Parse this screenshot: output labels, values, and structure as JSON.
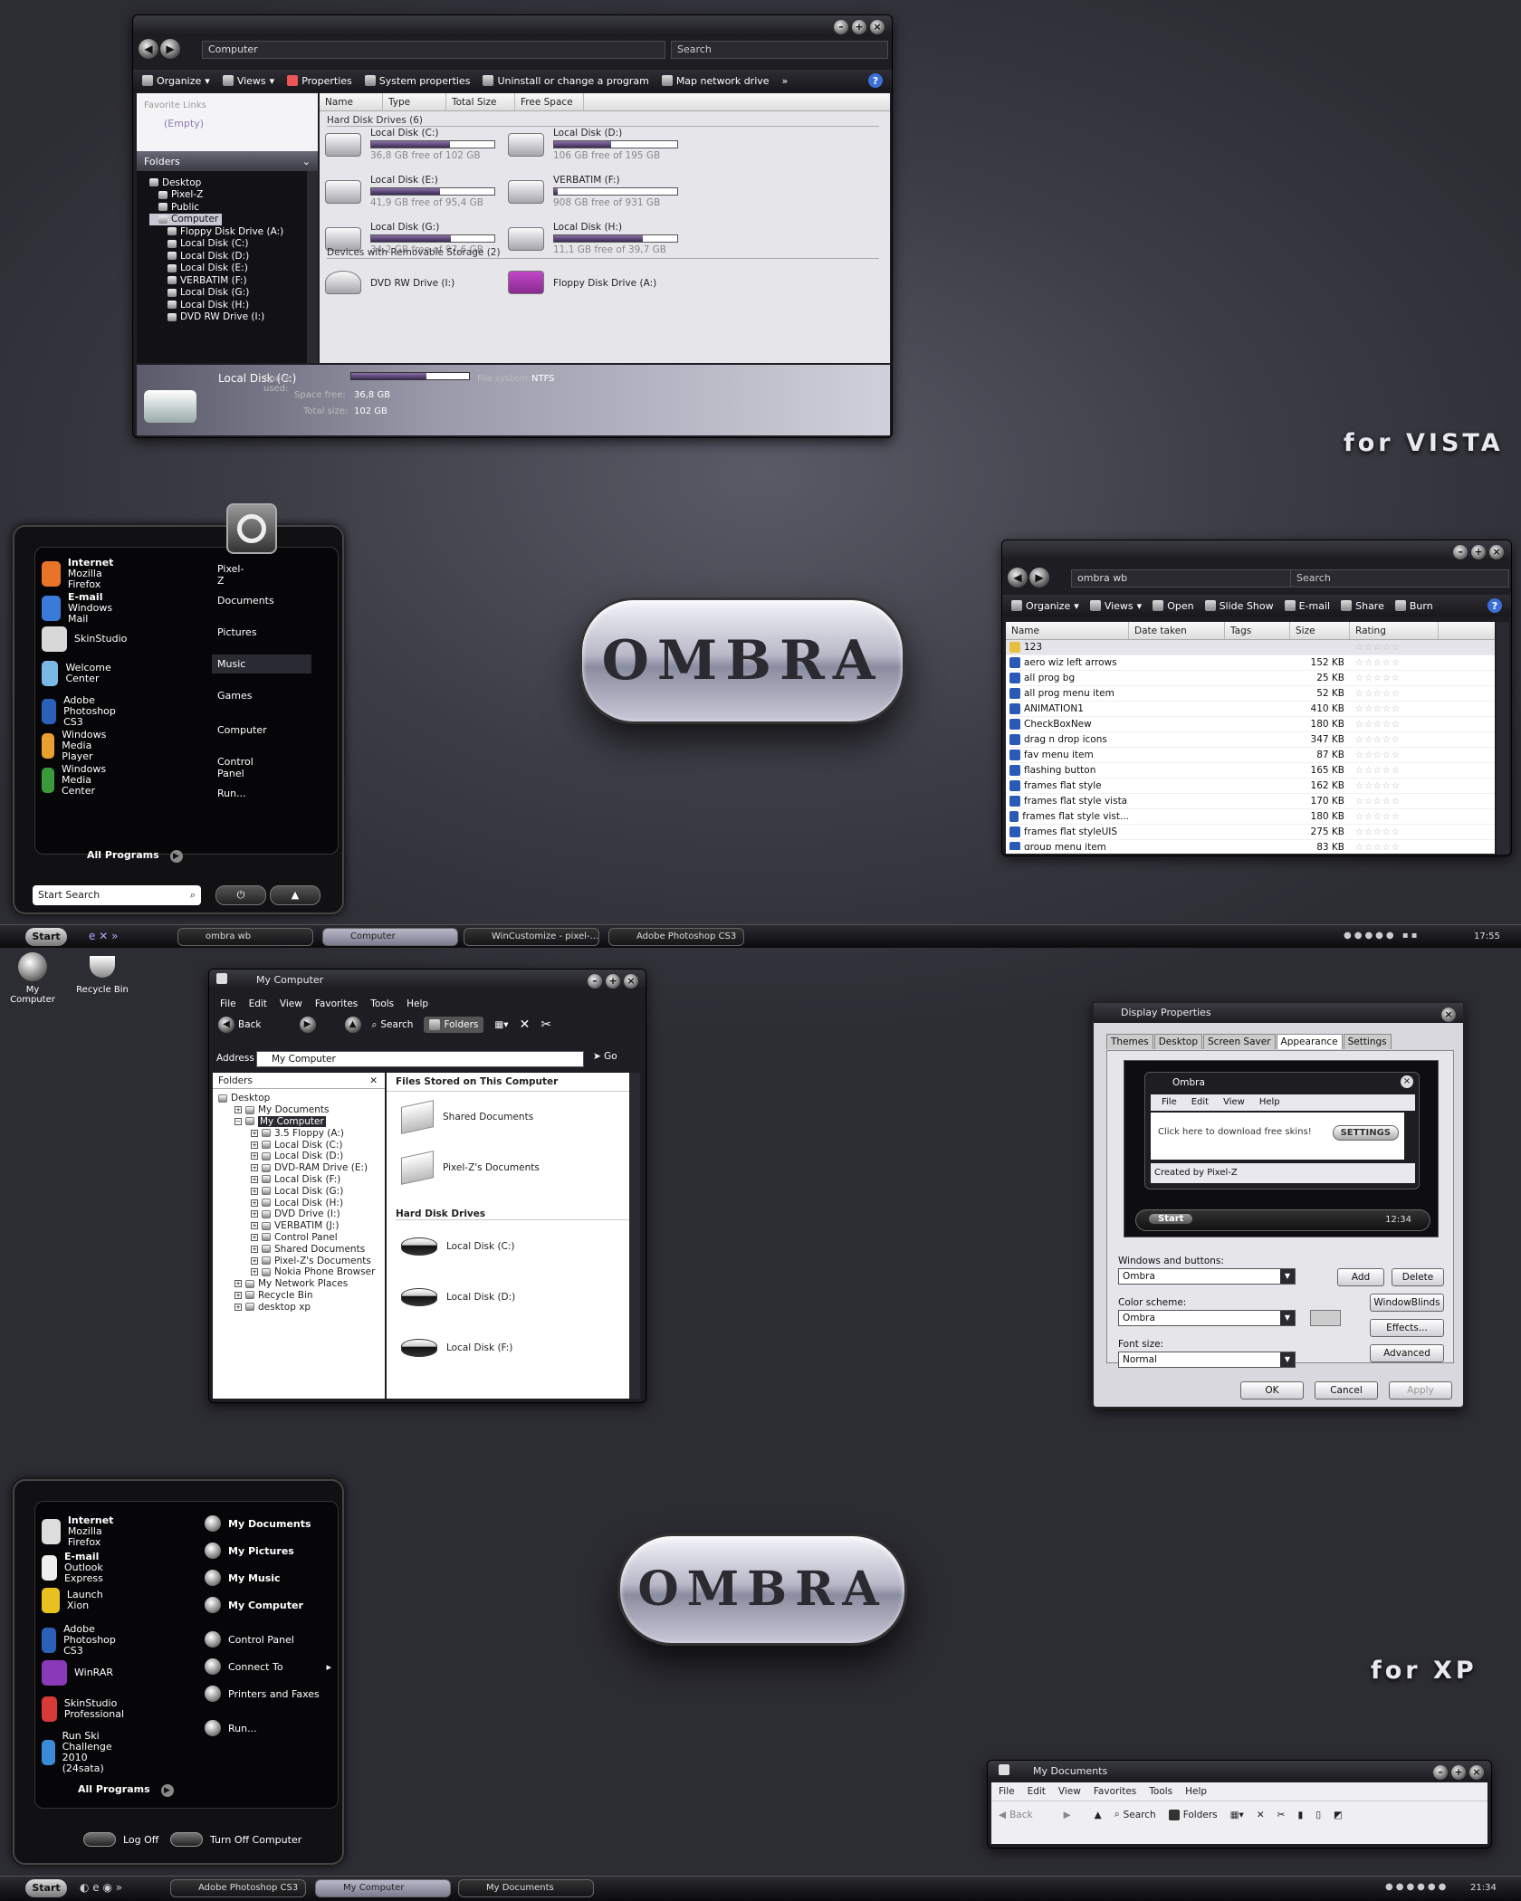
{
  "vista_explorer": {
    "address": "Computer",
    "search_placeholder": "Search",
    "toolbar": [
      "Organize",
      "Views",
      "Properties",
      "System properties",
      "Uninstall or change a program",
      "Map network drive"
    ],
    "favorite_links": "Favorite Links",
    "empty": "(Empty)",
    "folders": "Folders",
    "tree": [
      "Desktop",
      "Pixel-Z",
      "Public",
      "Computer",
      "Floppy Disk Drive (A:)",
      "Local Disk (C:)",
      "Local Disk (D:)",
      "Local Disk (E:)",
      "VERBATIM (F:)",
      "Local Disk (G:)",
      "Local Disk (H:)",
      "DVD RW Drive (I:)"
    ],
    "columns": [
      "Name",
      "Type",
      "Total Size",
      "Free Space"
    ],
    "group_hdd": "Hard Disk Drives (6)",
    "group_removable": "Devices with Removable Storage (2)",
    "drives": [
      {
        "name": "Local Disk (C:)",
        "free": "36,8 GB free of 102 GB",
        "used_fraction": 0.64
      },
      {
        "name": "Local Disk (D:)",
        "free": "106 GB free of 195 GB",
        "used_fraction": 0.46
      },
      {
        "name": "Local Disk (E:)",
        "free": "41,9 GB free of 95,4 GB",
        "used_fraction": 0.56
      },
      {
        "name": "VERBATIM (F:)",
        "free": "908 GB free of 931 GB",
        "used_fraction": 0.03
      },
      {
        "name": "Local Disk (G:)",
        "free": "34,2 GB free of 97,6 GB",
        "used_fraction": 0.65
      },
      {
        "name": "Local Disk (H:)",
        "free": "11,1 GB free of 39,7 GB",
        "used_fraction": 0.72
      }
    ],
    "removable": [
      "DVD RW Drive (I:)",
      "Floppy Disk Drive (A:)"
    ],
    "details": {
      "name": "Local Disk (C:)",
      "space_used_label": "Space used:",
      "space_free_label": "Space free:",
      "space_free": "36,8 GB",
      "total_label": "Total size:",
      "total": "102 GB",
      "fs_label": "File system:",
      "fs": "NTFS",
      "used_fraction": 0.64
    }
  },
  "tag_vista": "for VISTA",
  "tag_xp": "for XP",
  "logo": "OMBRA",
  "vista_start": {
    "left": [
      {
        "t": "Internet",
        "s": "Mozilla Firefox"
      },
      {
        "t": "E-mail",
        "s": "Windows Mail"
      },
      {
        "t": "SkinStudio",
        "s": ""
      },
      {
        "t": "Welcome Center",
        "s": ""
      },
      {
        "t": "Adobe Photoshop CS3",
        "s": ""
      },
      {
        "t": "Windows Media Player",
        "s": ""
      },
      {
        "t": "Windows Media Center",
        "s": ""
      }
    ],
    "right": [
      "Pixel-Z",
      "Documents",
      "Pictures",
      "Music",
      "Games",
      "Computer",
      "Control Panel",
      "Run..."
    ],
    "all_programs": "All Programs",
    "search": "Start Search"
  },
  "vista_browser": {
    "address": "ombra wb",
    "search": "Search",
    "toolbar": [
      "Organize",
      "Views",
      "Open",
      "Slide Show",
      "E-mail",
      "Share",
      "Burn"
    ],
    "columns": [
      "Name",
      "Date taken",
      "Tags",
      "Size",
      "Rating"
    ],
    "files": [
      {
        "n": "123",
        "s": ""
      },
      {
        "n": "aero wiz left arrows",
        "s": "152 KB"
      },
      {
        "n": "all prog bg",
        "s": "25 KB"
      },
      {
        "n": "all prog menu item",
        "s": "52 KB"
      },
      {
        "n": "ANIMATION1",
        "s": "410 KB"
      },
      {
        "n": "CheckBoxNew",
        "s": "180 KB"
      },
      {
        "n": "drag n drop icons",
        "s": "347 KB"
      },
      {
        "n": "fav menu item",
        "s": "87 KB"
      },
      {
        "n": "flashing button",
        "s": "165 KB"
      },
      {
        "n": "frames flat style",
        "s": "162 KB"
      },
      {
        "n": "frames flat style vista",
        "s": "170 KB"
      },
      {
        "n": "frames flat style vist...",
        "s": "180 KB"
      },
      {
        "n": "frames flat styleUIS",
        "s": "275 KB"
      },
      {
        "n": "group menu item",
        "s": "83 KB"
      }
    ]
  },
  "taskbar_vista": {
    "start": "Start",
    "buttons": [
      "ombra wb",
      "Computer",
      "WinCustomize - pixel-...",
      "Adobe Photoshop CS3"
    ],
    "clock": "17:55"
  },
  "desktop_icons": [
    "My Computer",
    "Recycle Bin"
  ],
  "xp_explorer": {
    "title": "My Computer",
    "menu": [
      "File",
      "Edit",
      "View",
      "Favorites",
      "Tools",
      "Help"
    ],
    "toolbar": [
      "Back",
      "Search",
      "Folders"
    ],
    "address_label": "Address",
    "address": "My Computer",
    "go": "Go",
    "folders": "Folders",
    "tree": [
      "Desktop",
      "My Documents",
      "My Computer",
      "3.5 Floppy (A:)",
      "Local Disk (C:)",
      "Local Disk (D:)",
      "DVD-RAM Drive (E:)",
      "Local Disk (F:)",
      "Local Disk (G:)",
      "Local Disk (H:)",
      "DVD Drive (I:)",
      "VERBATIM (J:)",
      "Control Panel",
      "Shared Documents",
      "Pixel-Z's Documents",
      "Nokia Phone Browser",
      "My Network Places",
      "Recycle Bin",
      "desktop xp"
    ],
    "section_files": "Files Stored on This Computer",
    "shared": [
      "Shared Documents",
      "Pixel-Z's Documents"
    ],
    "section_hdd": "Hard Disk Drives",
    "disks": [
      "Local Disk (C:)",
      "Local Disk (D:)",
      "Local Disk (F:)"
    ]
  },
  "display_props": {
    "title": "Display Properties",
    "tabs": [
      "Themes",
      "Desktop",
      "Screen Saver",
      "Appearance",
      "Settings"
    ],
    "preview": {
      "title": "Ombra",
      "menu": [
        "File",
        "Edit",
        "View",
        "Help"
      ],
      "text": "Click here to download free skins!",
      "btn": "SETTINGS",
      "status": "Created by Pixel-Z",
      "start": "Start",
      "clock": "12:34"
    },
    "wb_label": "Windows and buttons:",
    "wb_value": "Ombra",
    "cs_label": "Color scheme:",
    "cs_value": "Ombra",
    "fs_label": "Font size:",
    "fs_value": "Normal",
    "buttons": [
      "Add",
      "Delete",
      "WindowBlinds",
      "Effects...",
      "Advanced"
    ],
    "ok": "OK",
    "cancel": "Cancel",
    "apply": "Apply"
  },
  "xp_start": {
    "left": [
      {
        "t": "Internet",
        "s": "Mozilla Firefox"
      },
      {
        "t": "E-mail",
        "s": "Outlook Express"
      },
      {
        "t": "Launch Xion",
        "s": ""
      },
      {
        "t": "Adobe Photoshop CS3",
        "s": ""
      },
      {
        "t": "WinRAR",
        "s": ""
      },
      {
        "t": "SkinStudio Professional",
        "s": ""
      },
      {
        "t": "Run Ski Challenge 2010",
        "s": "(24sata)"
      }
    ],
    "right": [
      "My Documents",
      "My Pictures",
      "My Music",
      "My Computer",
      "Control Panel",
      "Connect To",
      "Printers and Faxes",
      "Run..."
    ],
    "all_programs": "All Programs",
    "logoff": "Log Off",
    "turnoff": "Turn Off Computer"
  },
  "xp_mydocs": {
    "title": "My Documents",
    "menu": [
      "File",
      "Edit",
      "View",
      "Favorites",
      "Tools",
      "Help"
    ],
    "toolbar": [
      "Back",
      "Search",
      "Folders"
    ]
  },
  "taskbar_xp": {
    "start": "Start",
    "buttons": [
      "Adobe Photoshop CS3",
      "My Computer",
      "My Documents"
    ],
    "clock": "21:34"
  }
}
